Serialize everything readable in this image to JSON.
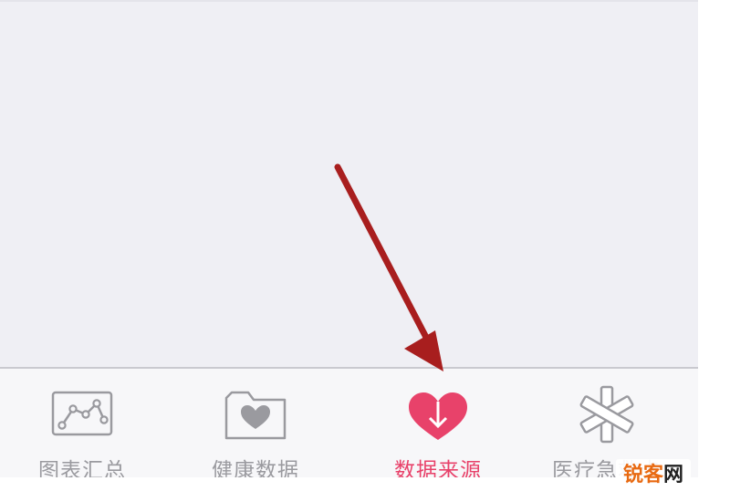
{
  "tabbar": {
    "tabs": [
      {
        "label": "图表汇总",
        "icon": "chart-icon",
        "active": false
      },
      {
        "label": "健康数据",
        "icon": "heart-folder-icon",
        "active": false
      },
      {
        "label": "数据来源",
        "icon": "heart-download-icon",
        "active": true
      },
      {
        "label": "医疗急救卡",
        "icon": "medical-asterisk-icon",
        "active": false
      }
    ]
  },
  "annotation": {
    "icon": "red-arrow-icon",
    "color": "#a81e1e"
  },
  "watermark": {
    "part1": "锐客",
    "part2": "网",
    "colors": {
      "part1": "#e86a12",
      "part2": "#222222"
    }
  },
  "colors": {
    "active": "#e8426a",
    "inactive": "#9a9a9f",
    "background": "#efeff4"
  }
}
